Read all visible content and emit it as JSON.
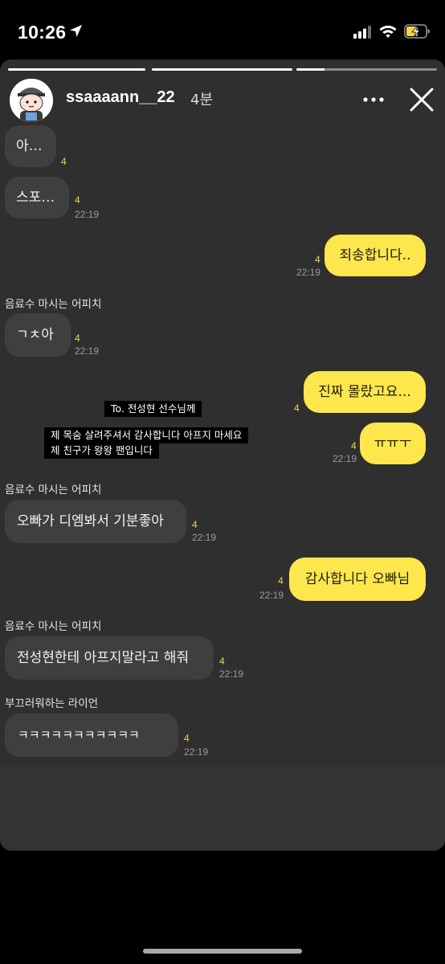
{
  "status_bar": {
    "time": "10:26",
    "icons": [
      "location-arrow-icon",
      "cellular-signal-icon",
      "wifi-icon",
      "battery-charging-icon"
    ]
  },
  "story": {
    "progress_bars": [
      {
        "fill": 1.0
      },
      {
        "fill": 1.0
      },
      {
        "fill": 0.2
      }
    ],
    "user": {
      "username": "ssaaaann__22",
      "age": "4분"
    },
    "colors": {
      "background": "#2f2f2f",
      "incoming_bubble": "#3f3f3f",
      "outgoing_bubble": "#fde74c",
      "unread_count": "#f2d54a"
    },
    "overlay": {
      "line1": "To. 전성현 선수님께",
      "line2": "제 목숨 살려주셔서 감사합니다 아프지 마세요",
      "line3": "제 친구가 왕왕 팬입니다"
    },
    "messages": [
      {
        "side": "in",
        "sender": "",
        "text": "아…",
        "unread": "4",
        "time": ""
      },
      {
        "side": "in",
        "sender": "",
        "text": "스포…",
        "unread": "4",
        "time": "22:19"
      },
      {
        "side": "out",
        "text": "죄송합니다..",
        "unread": "4",
        "time": "22:19"
      },
      {
        "side": "in",
        "sender": "음료수 마시는 어피치",
        "text": "ㄱㅊ아",
        "unread": "4",
        "time": "22:19"
      },
      {
        "side": "out",
        "text": "진짜 몰랐고요...",
        "unread": "4",
        "time": ""
      },
      {
        "side": "out",
        "text": "ㅠㅠㅜ",
        "unread": "4",
        "time": "22:19"
      },
      {
        "side": "in",
        "sender": "음료수 마시는 어피치",
        "text": "오빠가 디엠봐서 기분좋아",
        "unread": "4",
        "time": "22:19"
      },
      {
        "side": "out",
        "text": "감사합니다 오빠님",
        "unread": "4",
        "time": "22:19"
      },
      {
        "side": "in",
        "sender": "음료수 마시는 어피치",
        "text": "전성현한테 아프지말라고 해줘",
        "unread": "4",
        "time": "22:19"
      },
      {
        "side": "in",
        "sender": "부끄러워하는 라이언",
        "text": "ㅋㅋㅋㅋㅋㅋㅋㅋㅋㅋㅋ",
        "unread": "4",
        "time": "22:19"
      }
    ]
  }
}
